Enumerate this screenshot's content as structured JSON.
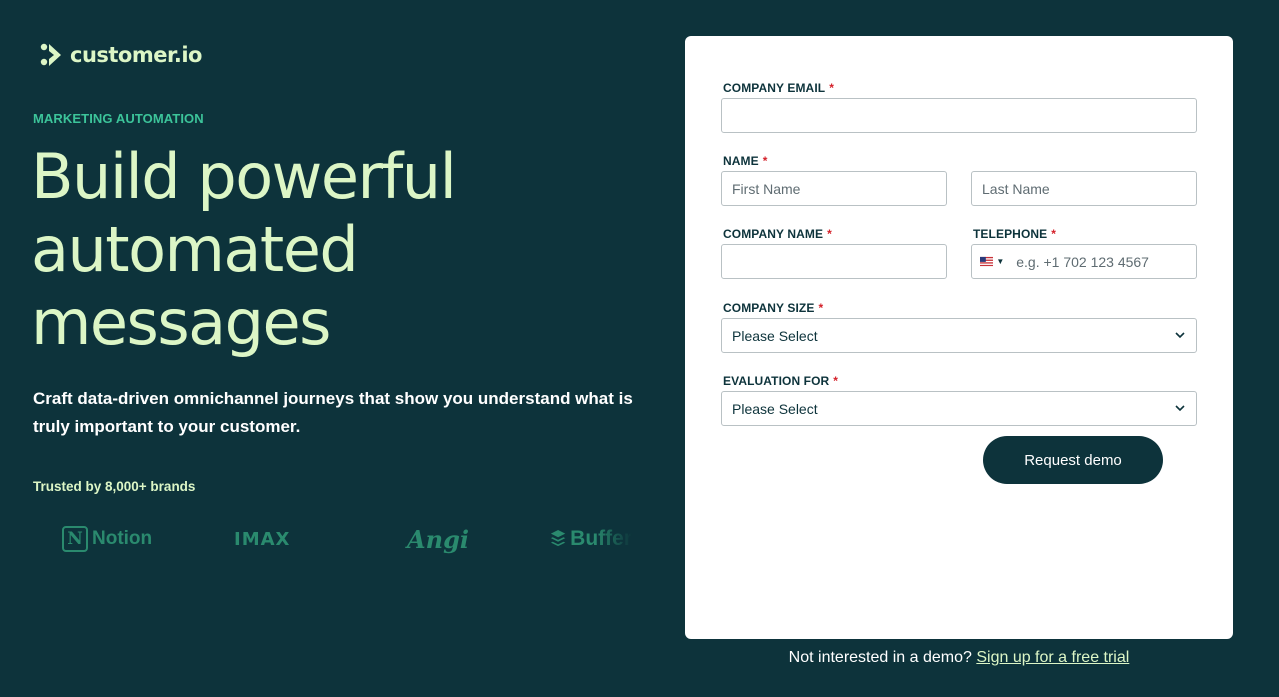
{
  "logo": {
    "text": "customer.io",
    "icon": "customer-io-logo-icon"
  },
  "hero": {
    "eyebrow": "MARKETING AUTOMATION",
    "headline": [
      "Build powerful",
      "automated",
      "messages"
    ],
    "subhead": "Craft data-driven omnichannel journeys that show you understand what is truly important to your customer.",
    "trusted": "Trusted by 8,000+ brands",
    "brands": [
      "Notion",
      "IMAX",
      "Angi",
      "Buffer"
    ]
  },
  "form": {
    "company_email": {
      "label": "COMPANY EMAIL",
      "value": ""
    },
    "name": {
      "label": "NAME",
      "first_placeholder": "First Name",
      "last_placeholder": "Last Name"
    },
    "company_name": {
      "label": "COMPANY NAME",
      "value": ""
    },
    "telephone": {
      "label": "TELEPHONE",
      "placeholder": "e.g. +1 702 123 4567",
      "country": "us-flag-icon"
    },
    "company_size": {
      "label": "COMPANY SIZE",
      "value": "Please Select"
    },
    "evaluation_for": {
      "label": "EVALUATION FOR",
      "value": "Please Select"
    },
    "required_mark": "*",
    "submit_label": "Request demo"
  },
  "footer": {
    "prefix": "Not interested in a demo?",
    "link": "Sign up for a free trial"
  },
  "colors": {
    "background": "#0d333b",
    "accent_light": "#dcf6c6",
    "accent_green": "#3cc49a",
    "required": "#d4212a"
  }
}
